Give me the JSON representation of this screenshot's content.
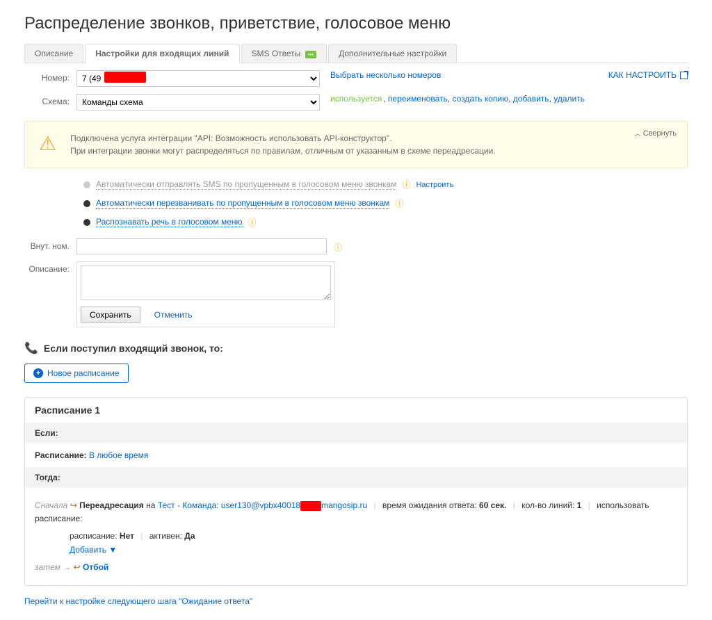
{
  "page_title": "Распределение звонков, приветствие, голосовое меню",
  "tabs": {
    "t0": "Описание",
    "t1": "Настройки для входящих линий",
    "t2": "SMS Ответы",
    "t3": "Дополнительные настройки"
  },
  "number": {
    "label": "Номер:",
    "value": "7 (49",
    "select_multi": "Выбрать несколько номеров",
    "howto": "КАК НАСТРОИТЬ"
  },
  "scheme": {
    "label": "Схема:",
    "value": "Команды схема",
    "used": "используется",
    "rename": "переименовать",
    "copy": "создать копию",
    "add": "добавить",
    "delete": "удалить"
  },
  "warning": {
    "line1": "Подключена услуга интеграции \"API: Возможность использовать API-конструктор\".",
    "line2": "При интеграции звонки могут распределяться по правилам, отличным от указанным в схеме переадресации.",
    "collapse": "Свернуть"
  },
  "options": {
    "o1": "Автоматически отправлять SMS по пропущенным в голосовом меню звонкам",
    "o1_cfg": "Настроить",
    "o2": "Автоматически перезванивать по пропущенным в голосовом меню звонкам",
    "o3": "Распознавать речь в голосовом меню"
  },
  "vnut": {
    "label": "Внут. ном."
  },
  "desc": {
    "label": "Описание:",
    "save": "Сохранить",
    "cancel": "Отменить"
  },
  "section": {
    "heading": "Если поступил входящий звонок, то:",
    "new_sched": "Новое расписание"
  },
  "sched": {
    "title": "Расписание 1",
    "if": "Если:",
    "sched_lbl": "Расписание:",
    "sched_val": "В любое время",
    "then": "Тогда:",
    "first": "Сначала",
    "redirect": "Переадресация",
    "on": "на",
    "target_prefix": "Тест - Команда: user130@vpbx40018",
    "target_suffix": "mangosip.ru",
    "wait_lbl": "время ожидания ответа:",
    "wait_val": "60 сек.",
    "lines_lbl": "кол-во линий:",
    "lines_val": "1",
    "use_sched": "использовать расписание:",
    "use_sched_val": "Нет",
    "active_lbl": "активен:",
    "active_val": "Да",
    "add": "Добавить ▼",
    "then_arrow": "затем →",
    "hangup": "Отбой"
  },
  "bottom": "Перейти к настройке следующего шага \"Ожидание ответа\""
}
